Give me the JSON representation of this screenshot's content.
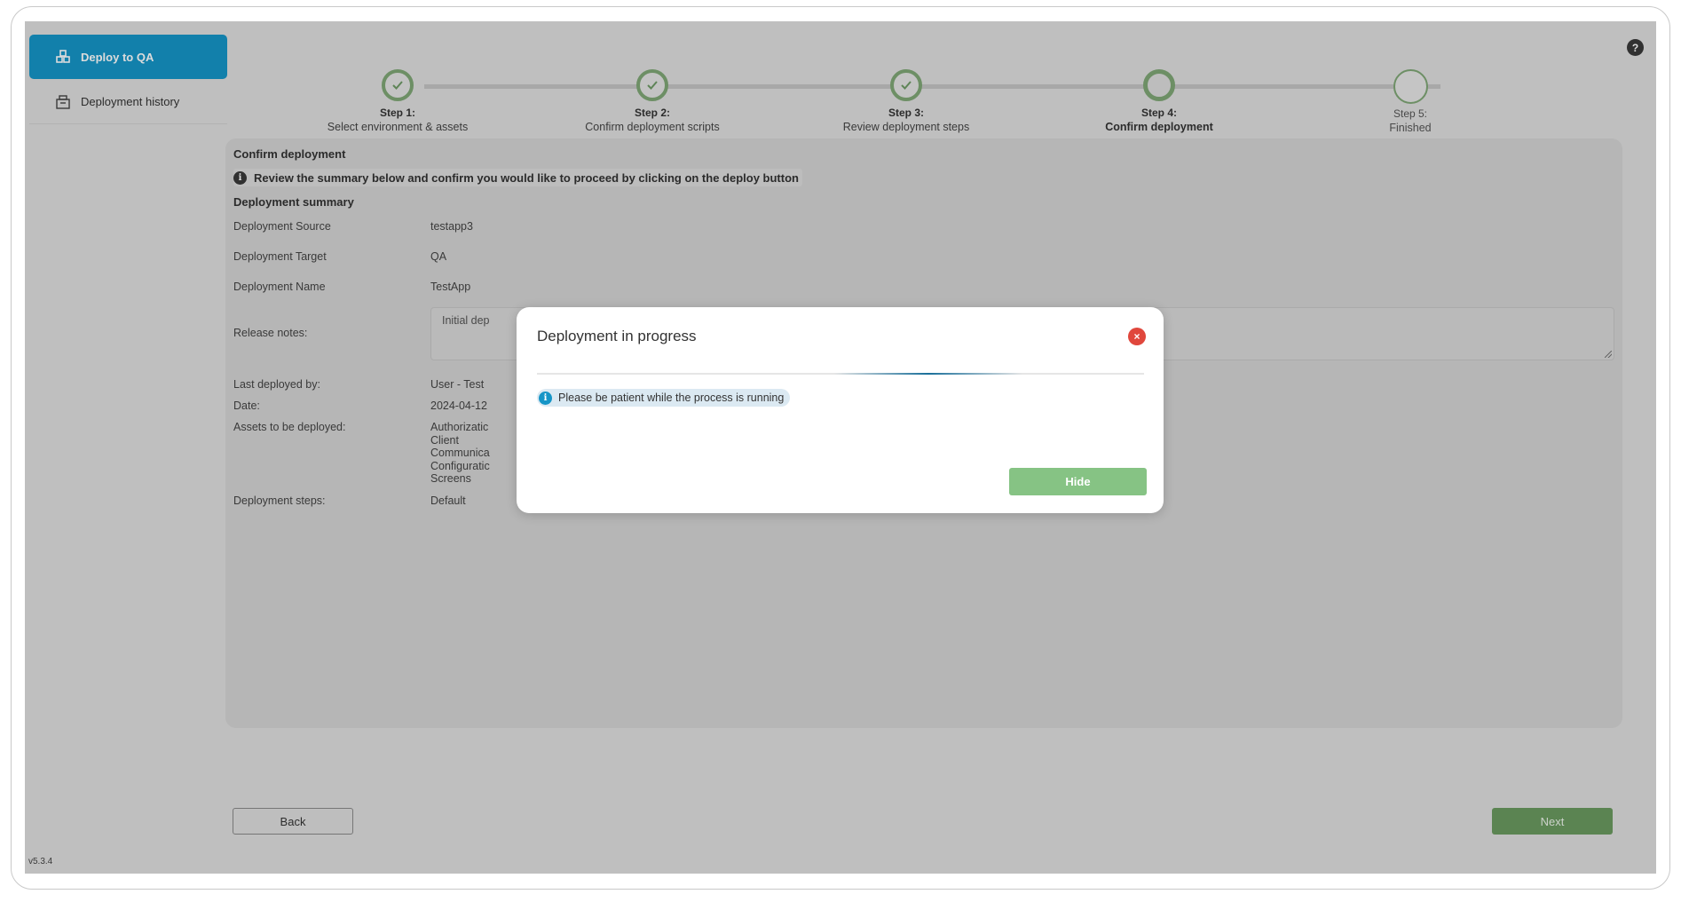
{
  "sidebar": {
    "items": [
      {
        "label": "Deploy to QA",
        "icon": "deploy-icon",
        "active": true
      },
      {
        "label": "Deployment history",
        "icon": "history-icon",
        "active": false
      }
    ],
    "version": "v5.3.4"
  },
  "help_label": "?",
  "stepper": {
    "steps": [
      {
        "title": "Step 1:",
        "subtitle": "Select environment & assets",
        "state": "done"
      },
      {
        "title": "Step 2:",
        "subtitle": "Confirm deployment scripts",
        "state": "done"
      },
      {
        "title": "Step 3:",
        "subtitle": "Review deployment steps",
        "state": "done"
      },
      {
        "title": "Step 4:",
        "subtitle": "Confirm deployment",
        "state": "current"
      },
      {
        "title": "Step 5:",
        "subtitle": "Finished",
        "state": "todo"
      }
    ]
  },
  "panel": {
    "title": "Confirm deployment",
    "info": "Review the summary below and confirm you would like to proceed by clicking on the deploy button",
    "summary_title": "Deployment summary",
    "rows": {
      "source": {
        "label": "Deployment Source",
        "value": "testapp3"
      },
      "target": {
        "label": "Deployment Target",
        "value": "QA"
      },
      "name": {
        "label": "Deployment Name",
        "value": "TestApp"
      },
      "notes": {
        "label": "Release notes:",
        "value": "Initial dep"
      },
      "last_deployed": {
        "label": "Last deployed by:",
        "value": "User - Test"
      },
      "date": {
        "label": "Date:",
        "value": "2024-04-12"
      },
      "assets": {
        "label": "Assets to be deployed:",
        "values": [
          "Authorizatic",
          "Client",
          "Communica",
          "Configuratic",
          "Screens"
        ]
      },
      "steps": {
        "label": "Deployment steps:",
        "value": "Default"
      }
    }
  },
  "buttons": {
    "back": "Back",
    "next": "Next"
  },
  "modal": {
    "title": "Deployment in progress",
    "close_symbol": "×",
    "info": "Please be patient while the process is running",
    "hide_label": "Hide",
    "progress_offset": 0.49,
    "progress_width": 0.31
  },
  "colors": {
    "accent": "#1595c7",
    "success": "#7fa776",
    "danger": "#e0473c"
  }
}
